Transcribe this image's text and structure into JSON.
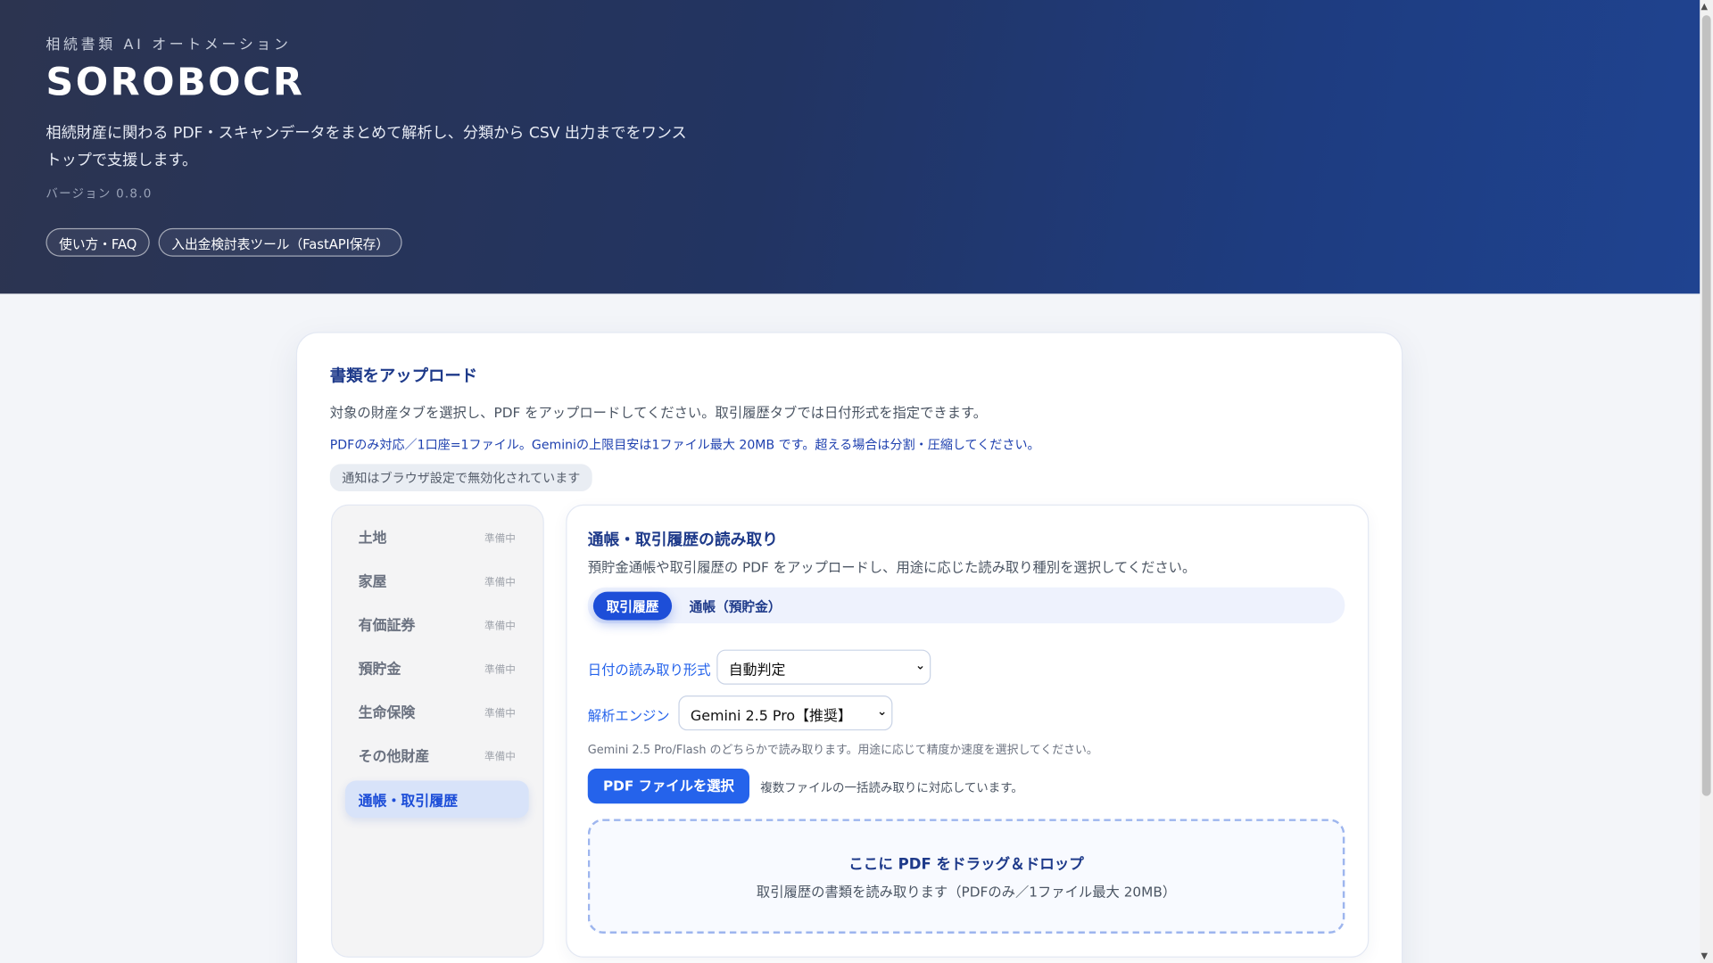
{
  "hero": {
    "eyebrow": "相続書類 AI オートメーション",
    "title": "SOROBOCR",
    "lead": "相続財産に関わる PDF・スキャンデータをまとめて解析し、分類から CSV 出力までをワンストップで支援します。",
    "version": "バージョン 0.8.0",
    "links": [
      "使い方・FAQ",
      "入出金検討表ツール（FastAPI保存）"
    ]
  },
  "upload": {
    "title": "書類をアップロード",
    "description": "対象の財産タブを選択し、PDF をアップロードしてください。取引履歴タブでは日付形式を指定できます。",
    "note": "PDFのみ対応／1口座=1ファイル。Geminiの上限目安は1ファイル最大 20MB です。超える場合は分割・圧縮してください。",
    "notification_badge": "通知はブラウザ設定で無効化されています"
  },
  "sidebar": {
    "items": [
      {
        "label": "土地",
        "status": "準備中"
      },
      {
        "label": "家屋",
        "status": "準備中"
      },
      {
        "label": "有価証券",
        "status": "準備中"
      },
      {
        "label": "預貯金",
        "status": "準備中"
      },
      {
        "label": "生命保険",
        "status": "準備中"
      },
      {
        "label": "その他財産",
        "status": "準備中"
      },
      {
        "label": "通帳・取引履歴",
        "active": true
      }
    ]
  },
  "panel": {
    "title": "通帳・取引履歴の読み取り",
    "description": "預貯金通帳や取引履歴の PDF をアップロードし、用途に応じた読み取り種別を選択してください。",
    "tabs": [
      {
        "label": "取引履歴",
        "active": true
      },
      {
        "label": "通帳（預貯金）",
        "active": false
      }
    ],
    "date_format_label": "日付の読み取り形式",
    "date_format_value": "自動判定",
    "engine_label": "解析エンジン",
    "engine_value": "Gemini 2.5 Pro【推奨】",
    "engine_hint": "Gemini 2.5 Pro/Flash のどちらかで読み取ります。用途に応じて精度か速度を選択してください。",
    "select_button": "PDF ファイルを選択",
    "select_note": "複数ファイルの一括読み取りに対応しています。",
    "dropzone_title": "ここに PDF をドラッグ＆ドロップ",
    "dropzone_sub": "取引履歴の書類を読み取ります（PDFのみ／1ファイル最大 20MB）"
  },
  "colors": {
    "accent": "#2563eb",
    "heading": "#1e3a8a",
    "hero_start": "#2c3450",
    "hero_end": "#1f4390"
  }
}
